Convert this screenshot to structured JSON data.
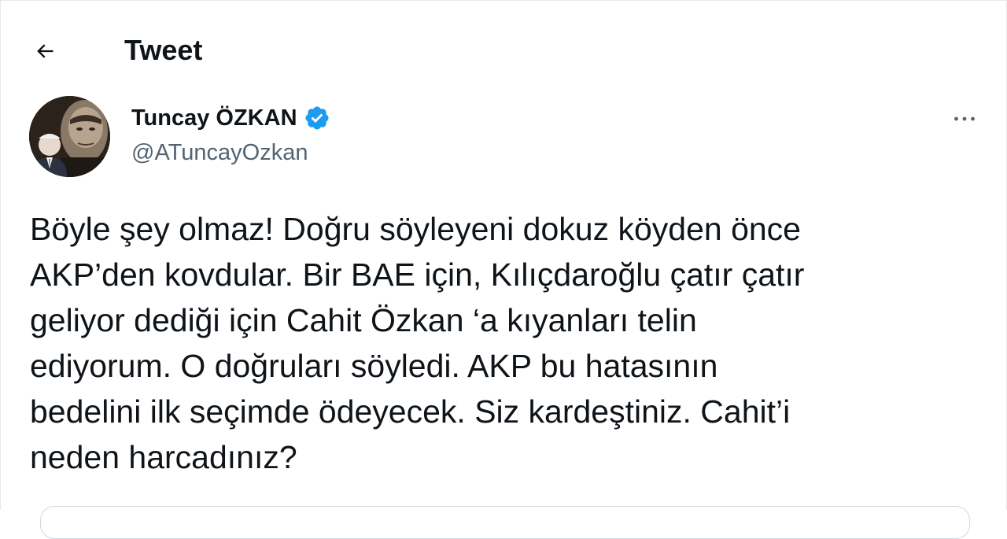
{
  "header": {
    "title": "Tweet",
    "back_icon": "arrow-left-icon"
  },
  "tweet": {
    "author": {
      "name": "Tuncay ÖZKAN",
      "handle": "@ATuncayOzkan",
      "verified": true,
      "verified_icon": "verified-badge-icon",
      "verified_color": "#1d9bf0"
    },
    "more_icon": "more-horizontal-icon",
    "text": "Böyle şey olmaz! Doğru söyleyeni dokuz köyden önce\nAKP’den kovdular. Bir BAE için, Kılıçdaroğlu çatır çatır\ngeliyor dediği için Cahit Özkan ‘a kıyanları telin\nediyorum. O doğruları söyledi. AKP bu hatasının\nbedelini ilk seçimde ödeyecek. Siz kardeştiniz. Cahit’i\nneden harcadınız?"
  },
  "colors": {
    "text": "#0f1419",
    "secondary_text": "#536471",
    "border": "#cfd9de",
    "accent": "#1d9bf0"
  }
}
